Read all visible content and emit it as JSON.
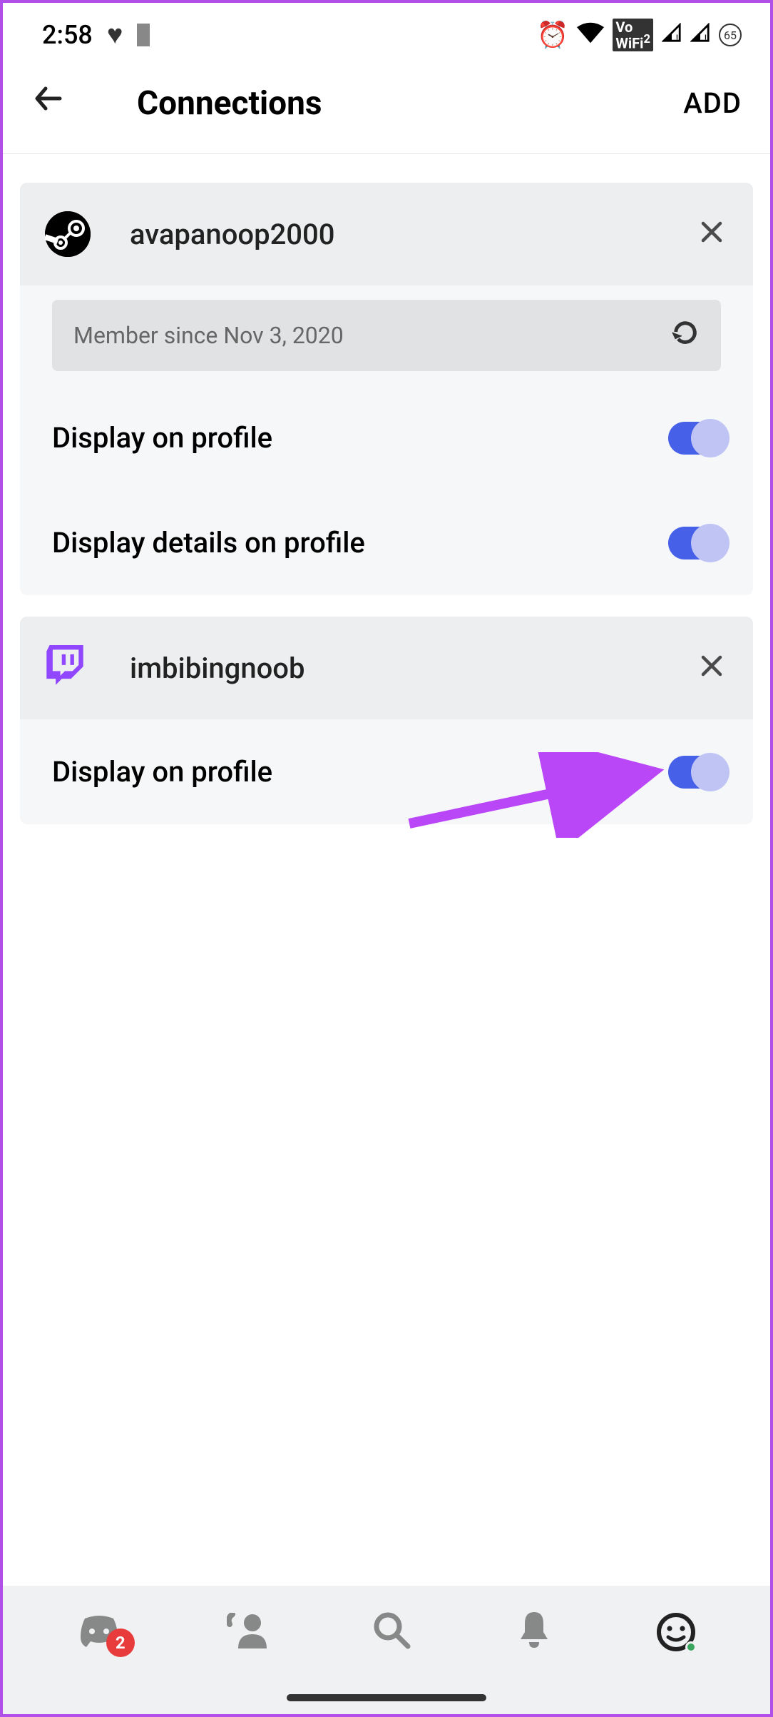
{
  "statusbar": {
    "time": "2:58",
    "battery_level": "65"
  },
  "header": {
    "title": "Connections",
    "add_label": "ADD"
  },
  "connections": [
    {
      "service": "steam",
      "username": "avapanoop2000",
      "member_since": "Member since Nov 3, 2020",
      "settings": [
        {
          "label": "Display on profile",
          "enabled": true
        },
        {
          "label": "Display details on profile",
          "enabled": true
        }
      ]
    },
    {
      "service": "twitch",
      "username": "imbibingnoob",
      "settings": [
        {
          "label": "Display on profile",
          "enabled": true
        }
      ]
    }
  ],
  "bottomnav": {
    "badge_count": "2"
  }
}
